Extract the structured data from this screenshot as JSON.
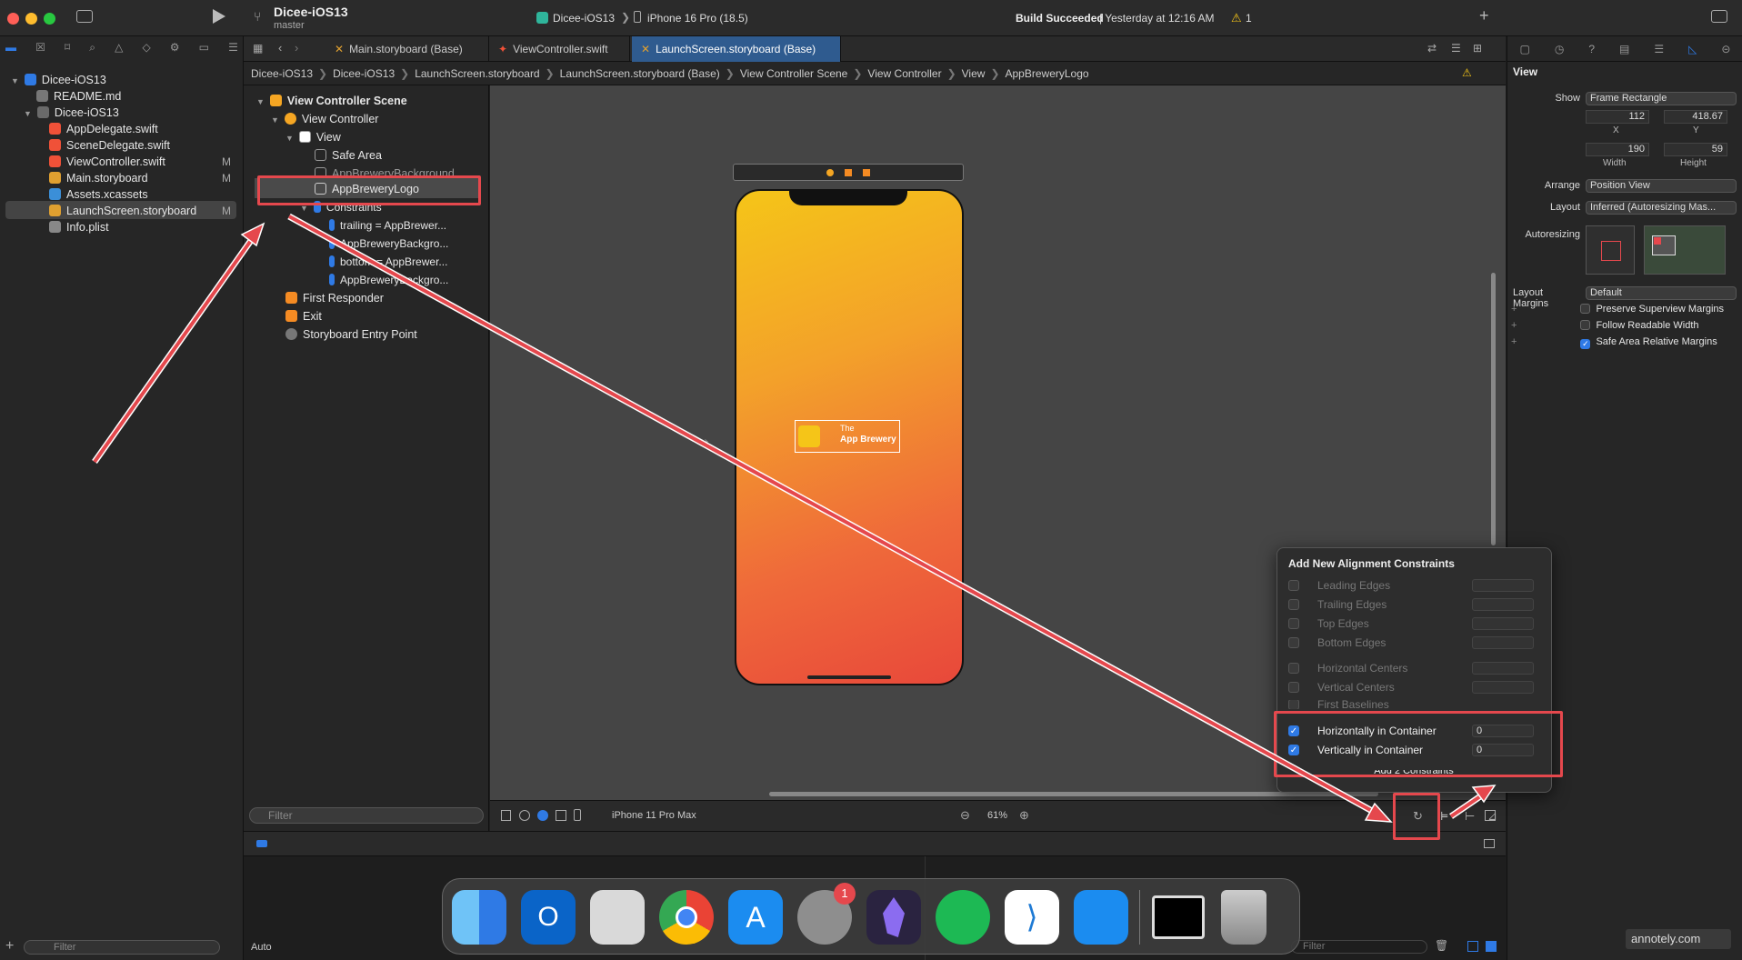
{
  "titlebar": {
    "project": "Dicee-iOS13",
    "branch": "master",
    "scheme": "Dicee-iOS13",
    "device": "iPhone 16 Pro (18.5)",
    "status_bold": "Build Succeeded",
    "status_rest": " | Yesterday at 12:16 AM",
    "warnings": "1"
  },
  "navigator": {
    "items": [
      {
        "label": "Dicee-iOS13",
        "icon": "project-icon",
        "badge": ""
      },
      {
        "label": "README.md",
        "icon": "document-icon",
        "badge": ""
      },
      {
        "label": "Dicee-iOS13",
        "icon": "folder-icon",
        "badge": ""
      },
      {
        "label": "AppDelegate.swift",
        "icon": "swift-icon",
        "badge": ""
      },
      {
        "label": "SceneDelegate.swift",
        "icon": "swift-icon",
        "badge": ""
      },
      {
        "label": "ViewController.swift",
        "icon": "swift-icon",
        "badge": "M"
      },
      {
        "label": "Main.storyboard",
        "icon": "storyboard-icon",
        "badge": "M"
      },
      {
        "label": "Assets.xcassets",
        "icon": "assets-icon",
        "badge": ""
      },
      {
        "label": "LaunchScreen.storyboard",
        "icon": "storyboard-icon",
        "badge": "M"
      },
      {
        "label": "Info.plist",
        "icon": "plist-icon",
        "badge": ""
      }
    ],
    "filter_placeholder": "Filter"
  },
  "tabs": [
    "Main.storyboard (Base)",
    "ViewController.swift",
    "LaunchScreen.storyboard (Base)"
  ],
  "jumpbar": [
    "Dicee-iOS13",
    "Dicee-iOS13",
    "LaunchScreen.storyboard",
    "LaunchScreen.storyboard (Base)",
    "View Controller Scene",
    "View Controller",
    "View",
    "AppBreweryLogo"
  ],
  "outline": {
    "items": [
      "View Controller Scene",
      "View Controller",
      "View",
      "Safe Area",
      "AppBreweryBackground",
      "AppBreweryLogo",
      "Constraints",
      "trailing = AppBrewer...",
      "AppBreweryBackgro...",
      "bottom = AppBrewer...",
      "AppBreweryBackgro...",
      "First Responder",
      "Exit",
      "Storyboard Entry Point"
    ],
    "filter_placeholder": "Filter"
  },
  "canvas": {
    "logo_line1": "The",
    "logo_line2": "App Brewery",
    "device_config": "iPhone 11 Pro Max",
    "zoom": "61%"
  },
  "popover": {
    "title": "Add New Alignment Constraints",
    "rows": [
      "Leading Edges",
      "Trailing Edges",
      "Top Edges",
      "Bottom Edges",
      "Horizontal Centers",
      "Vertical Centers",
      "First Baselines"
    ],
    "checked_rows": [
      {
        "label": "Horizontally in Container",
        "value": "0"
      },
      {
        "label": "Vertically in Container",
        "value": "0"
      }
    ],
    "button": "Add 2 Constraints"
  },
  "inspector": {
    "title": "View",
    "show_label": "Show",
    "show_value": "Frame Rectangle",
    "x": "112",
    "y": "418.67",
    "x_label": "X",
    "y_label": "Y",
    "width": "190",
    "height": "59",
    "width_label": "Width",
    "height_label": "Height",
    "arrange_label": "Arrange",
    "arrange_value": "Position View",
    "layout_label": "Layout",
    "layout_value": "Inferred (Autoresizing Mas...",
    "autoresizing_label": "Autoresizing",
    "margins_label": "Layout Margins",
    "margins_value": "Default",
    "checks": [
      {
        "label": "Preserve Superview Margins",
        "checked": false
      },
      {
        "label": "Follow Readable Width",
        "checked": false
      },
      {
        "label": "Safe Area Relative Margins",
        "checked": true
      }
    ]
  },
  "bottom": {
    "auto": "Auto",
    "filter_placeholder": "Filter",
    "watermark": "annotely.com"
  },
  "dock": {
    "apps": [
      "Finder",
      "Outlook",
      "Launchpad",
      "Chrome",
      "App Store",
      "System Settings",
      "Obsidian",
      "Spotify",
      "VS Code",
      "Xcode",
      "Terminal",
      "Trash"
    ],
    "settings_badge": "1"
  },
  "colors": {
    "accent": "#2f7ae5",
    "annotation": "#e5484d",
    "tab_active": "#2f5b8f"
  }
}
